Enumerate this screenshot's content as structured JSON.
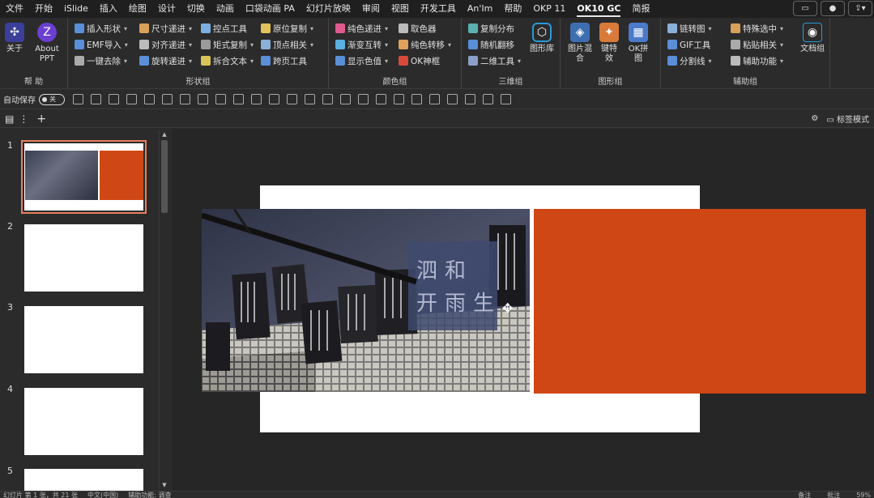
{
  "menu": {
    "tabs": [
      "文件",
      "开始",
      "iSlide",
      "插入",
      "绘图",
      "设计",
      "切换",
      "动画",
      "口袋动画 PA",
      "幻灯片放映",
      "审阅",
      "视图",
      "开发工具",
      "An'Im",
      "帮助",
      "OKP 11",
      "OK10 GC",
      "简报"
    ],
    "active_tab": "OK10 GC"
  },
  "ribbon": {
    "help_group": {
      "label": "帮 助",
      "about_label": "关于",
      "about_ppt_label": "About PPT"
    },
    "shape_group": {
      "label": "形状组",
      "items": [
        "插入形状",
        "尺寸递进",
        "控点工具",
        "原位复制",
        "EMF导入",
        "对齐递进",
        "矩式复制",
        "顶点相关",
        "一键去除",
        "旋转递进",
        "拆合文本",
        "跨页工具"
      ]
    },
    "color_group": {
      "label": "颜色组",
      "items": [
        "纯色递进",
        "取色器",
        "渐变互转",
        "纯色转移",
        "显示色值",
        "OK神框"
      ]
    },
    "3d_group": {
      "label": "三维组",
      "items": [
        "复制分布",
        "随机翻移",
        "二维工具"
      ],
      "big_label": "图形库"
    },
    "graphic_group": {
      "label": "图形组",
      "items": [
        "图片混合",
        "键特效",
        "OK拼图"
      ]
    },
    "aux_group": {
      "label": "辅助组",
      "items": [
        "链转图",
        "特殊选中",
        "GIF工具",
        "粘贴相关",
        "分割线",
        "辅助功能"
      ],
      "doc_label": "文档组"
    }
  },
  "quickbar": {
    "autosave_label": "自动保存",
    "toggle_label": "关"
  },
  "tabstrip": {
    "view_label": "标签模式"
  },
  "slides": [
    {
      "number": "1",
      "selected": true
    },
    {
      "number": "2",
      "selected": false
    },
    {
      "number": "3",
      "selected": false
    },
    {
      "number": "4",
      "selected": false
    },
    {
      "number": "5",
      "selected": false
    }
  ],
  "canvas": {
    "photo_text": [
      "和",
      "泗",
      "开",
      "雨",
      "生"
    ],
    "orange_color": "#cf4715"
  },
  "status": {
    "left": [
      "幻灯片 第 1 张，共 21 张",
      "中文(中国)",
      "辅助功能: 调查"
    ],
    "right": [
      "备注",
      "批注",
      "59%"
    ]
  }
}
